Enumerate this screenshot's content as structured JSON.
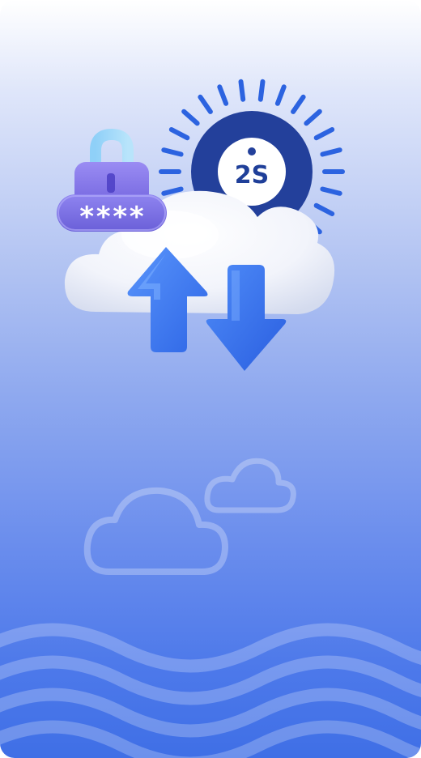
{
  "hero": {
    "logo_text": "2S",
    "password_mask": "****",
    "icons": [
      "sun-badge-icon",
      "padlock-icon",
      "cloud-icon",
      "upload-arrow-icon",
      "download-arrow-icon"
    ]
  },
  "background": {
    "decor": [
      "outline-cloud-icon",
      "outline-cloud-icon",
      "wave-pattern"
    ]
  },
  "colors": {
    "gradient_top": "#ffffff",
    "gradient_bottom": "#3f6fe6",
    "sun_navy": "#23409b",
    "sun_rays": "#2c63e0",
    "lock_purple": "#7b6ee6",
    "arrow_blue": "#3d7af0"
  }
}
